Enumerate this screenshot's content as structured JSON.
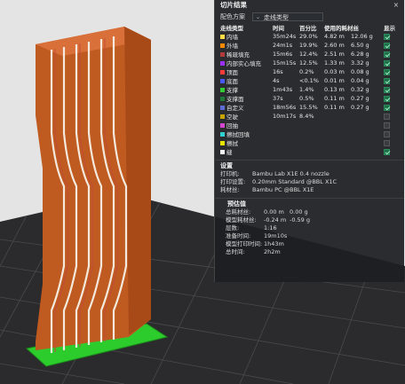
{
  "panel": {
    "title": "切片结果",
    "close_label": "×",
    "scheme_label": "配色方案",
    "scheme_value": "走线类型",
    "headers": {
      "type": "走线类型",
      "time": "时间",
      "percent": "百分比",
      "usage": "使用的耗材丝",
      "show": "显示"
    },
    "rows": [
      {
        "name": "内墙",
        "time": "35m24s",
        "percent": "29.0%",
        "meters": "4.82 m",
        "grams": "12.06 g",
        "color": "#ffdd44",
        "shown": true
      },
      {
        "name": "外墙",
        "time": "24m1s",
        "percent": "19.9%",
        "meters": "2.60 m",
        "grams": "6.50 g",
        "color": "#ff8a00",
        "shown": true
      },
      {
        "name": "稀疏填充",
        "time": "15m6s",
        "percent": "12.4%",
        "meters": "2.51 m",
        "grams": "6.28 g",
        "color": "#b33a3a",
        "shown": true
      },
      {
        "name": "内部实心填充",
        "time": "15m15s",
        "percent": "12.5%",
        "meters": "1.33 m",
        "grams": "3.32 g",
        "color": "#9b30ff",
        "shown": true
      },
      {
        "name": "顶面",
        "time": "16s",
        "percent": "0.2%",
        "meters": "0.03 m",
        "grams": "0.08 g",
        "color": "#ff3b3b",
        "shown": true
      },
      {
        "name": "底面",
        "time": "4s",
        "percent": "<0.1%",
        "meters": "0.01 m",
        "grams": "0.04 g",
        "color": "#4a59ff",
        "shown": true
      },
      {
        "name": "支撑",
        "time": "1m43s",
        "percent": "1.4%",
        "meters": "0.13 m",
        "grams": "0.32 g",
        "color": "#33cc33",
        "shown": true
      },
      {
        "name": "支撑面",
        "time": "37s",
        "percent": "0.5%",
        "meters": "0.11 m",
        "grams": "0.27 g",
        "color": "#1f7a3a",
        "shown": true
      },
      {
        "name": "自定义",
        "time": "18m56s",
        "percent": "15.5%",
        "meters": "0.11 m",
        "grams": "0.27 g",
        "color": "#5c6bd6",
        "shown": true
      },
      {
        "name": "空驶",
        "time": "10m17s",
        "percent": "8.4%",
        "meters": "",
        "grams": "",
        "color": "#c8a400",
        "shown": false
      },
      {
        "name": "回抽",
        "time": "",
        "percent": "",
        "meters": "",
        "grams": "",
        "color": "#d246d2",
        "shown": false
      },
      {
        "name": "擦拭回填",
        "time": "",
        "percent": "",
        "meters": "",
        "grams": "",
        "color": "#2fd0d0",
        "shown": false
      },
      {
        "name": "擦拭",
        "time": "",
        "percent": "",
        "meters": "",
        "grams": "",
        "color": "#e6e600",
        "shown": false
      },
      {
        "name": "缝",
        "time": "",
        "percent": "",
        "meters": "",
        "grams": "",
        "color": "#f5f5f5",
        "shown": true
      }
    ],
    "settings": {
      "title": "设置",
      "printer_label": "打印机:",
      "printer_value": "Bambu Lab X1E 0.4 nozzle",
      "print_settings_label": "打印设置:",
      "print_settings_value": "0.20mm Standard @BBL X1C",
      "filament_label": "耗材丝:",
      "filament_value": "Bambu PC @BBL X1E"
    },
    "estimate": {
      "title": "预估值",
      "total_filament_label": "总耗材丝:",
      "total_filament_m": "0.00 m",
      "total_filament_g": "0.00 g",
      "model_filament_label": "模型耗材丝:",
      "model_filament_m": "-0.24 m",
      "model_filament_g": "-0.59 g",
      "layers_label": "层数:",
      "layers_value": "1:16",
      "prep_time_label": "准备时间:",
      "prep_time_value": "19m10s",
      "model_print_time_label": "模型打印时间:",
      "model_print_time_value": "1h43m",
      "total_time_label": "总时间:",
      "total_time_value": "2h2m"
    }
  }
}
